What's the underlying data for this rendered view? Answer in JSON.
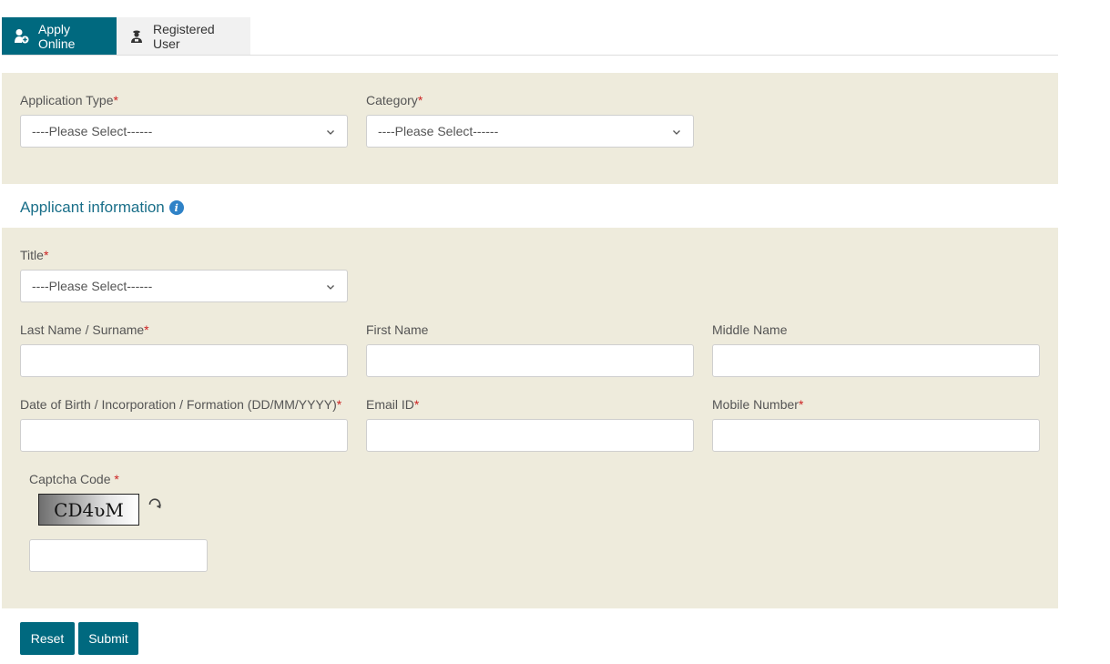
{
  "tabs": [
    {
      "label": "Apply Online",
      "icon": "user-plus-icon",
      "active": true
    },
    {
      "label": "Registered User",
      "icon": "registered-user-icon",
      "active": false
    }
  ],
  "application": {
    "type_label": "Application Type",
    "type_value": "----Please Select------",
    "category_label": "Category",
    "category_value": "----Please Select------"
  },
  "applicant": {
    "section_title": "Applicant information",
    "title_label": "Title",
    "title_value": "----Please Select------",
    "last_name_label": "Last Name / Surname",
    "first_name_label": "First Name",
    "middle_name_label": "Middle Name",
    "dob_label": "Date of Birth / Incorporation / Formation (DD/MM/YYYY)",
    "email_label": "Email ID",
    "mobile_label": "Mobile Number",
    "captcha_label": "Captcha Code",
    "captcha_text": "CD4ʋM"
  },
  "required_mark": "*",
  "buttons": {
    "reset": "Reset",
    "submit": "Submit"
  },
  "colors": {
    "accent": "#00697f",
    "panel": "#eeebdc",
    "required": "#cc2222",
    "section_title": "#1a6f89"
  }
}
